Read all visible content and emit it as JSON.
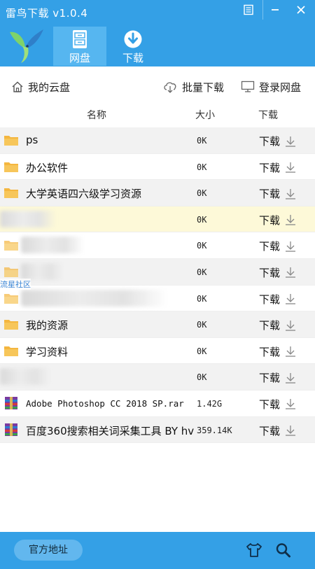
{
  "app": {
    "title": "雷鸟下载 v1.0.4"
  },
  "nav": {
    "tabs": [
      {
        "label": "网盘",
        "icon": "cabinet-icon",
        "active": true
      },
      {
        "label": "下载",
        "icon": "download-circle-icon",
        "active": false
      }
    ]
  },
  "toolbar": {
    "home_label": "我的云盘",
    "batch_label": "批量下载",
    "login_label": "登录网盘"
  },
  "table": {
    "headers": {
      "name": "名称",
      "size": "大小",
      "action": "下载"
    }
  },
  "files": [
    {
      "type": "folder",
      "name": "ps",
      "size": "0K",
      "action": "下载"
    },
    {
      "type": "folder",
      "name": "办公软件",
      "size": "0K",
      "action": "下载"
    },
    {
      "type": "folder",
      "name": "大学英语四六级学习资源",
      "size": "0K",
      "action": "下载"
    },
    {
      "type": "folder",
      "name": "",
      "size": "0K",
      "action": "下载"
    },
    {
      "type": "folder",
      "name": "",
      "size": "0K",
      "action": "下载"
    },
    {
      "type": "folder",
      "name": "",
      "size": "0K",
      "action": "下载"
    },
    {
      "type": "folder",
      "name": "",
      "size": "0K",
      "action": "下载"
    },
    {
      "type": "folder",
      "name": "我的资源",
      "size": "0K",
      "action": "下载"
    },
    {
      "type": "folder",
      "name": "学习资料",
      "size": "0K",
      "action": "下载"
    },
    {
      "type": "folder",
      "name": "",
      "size": "0K",
      "action": "下载"
    },
    {
      "type": "archive",
      "name": "Adobe Photoshop CC 2018 SP.rar",
      "size": "1.42G",
      "action": "下载"
    },
    {
      "type": "archive",
      "name": "百度360搜索相关词采集工具 BY hv",
      "size": "359.14K",
      "action": "下载"
    }
  ],
  "watermark": "流星社区",
  "footer": {
    "official_label": "官方地址",
    "icons": [
      "shirt-icon",
      "search-icon"
    ]
  },
  "colors": {
    "accent": "#34a0e6",
    "tab_active": "#56b6f0",
    "row_alt": "#f2f2f2",
    "row_highlight": "#fdf9d8",
    "folder": "#f4b63f"
  }
}
